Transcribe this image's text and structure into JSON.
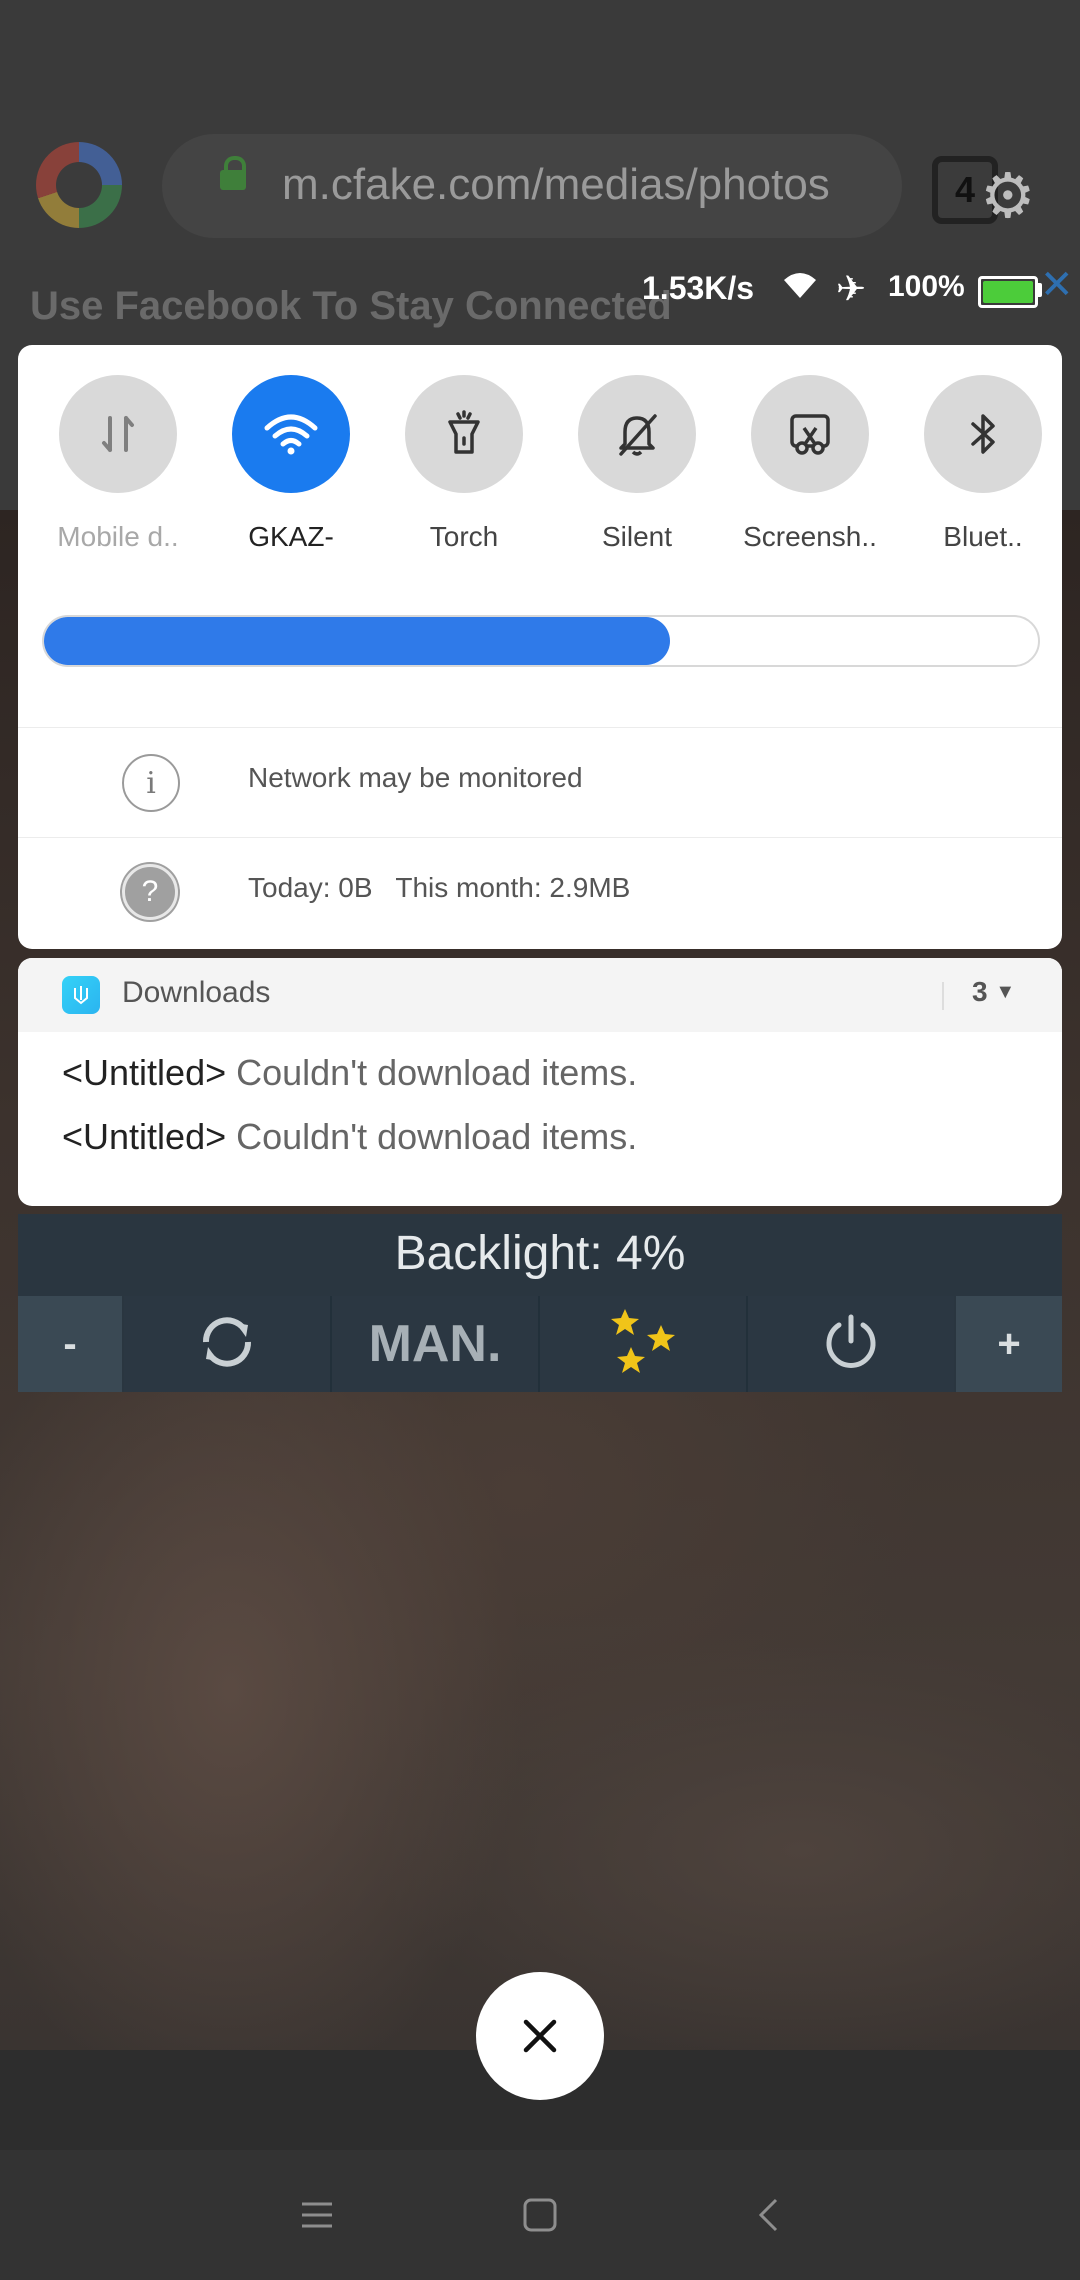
{
  "browser": {
    "url": "m.cfake.com/medias/photos",
    "tab_count": "4",
    "banner_text": "Use Facebook To Stay Connected",
    "banner_close": "✕"
  },
  "status_bar": {
    "speed": "1.53K/s",
    "battery_text": "100%",
    "battery_level": 1.0,
    "battery_color": "#4ccc3a"
  },
  "quick_settings": {
    "tiles": [
      {
        "label": "Mobile d..",
        "icon": "mobile-data-icon",
        "active": false
      },
      {
        "label": "GKAZ-",
        "icon": "wifi-icon",
        "active": true
      },
      {
        "label": "Torch",
        "icon": "torch-icon",
        "active": false
      },
      {
        "label": "Silent",
        "icon": "silent-bell-icon",
        "active": false
      },
      {
        "label": "Screensh..",
        "icon": "screenshot-icon",
        "active": false
      },
      {
        "label": "Bluet..",
        "icon": "bluetooth-icon",
        "active": false
      }
    ],
    "brightness_level": 0.63,
    "accent": "#1a7bef",
    "network_notice": "Network may be monitored",
    "data_usage": "Today: 0B   This month: 2.9MB"
  },
  "downloads": {
    "app_name": "Downloads",
    "count": "3",
    "items": [
      {
        "title": "<Untitled>",
        "message": "Couldn't download items."
      },
      {
        "title": "<Untitled>",
        "message": "Couldn't download items."
      }
    ]
  },
  "backlight": {
    "title": "Backlight: 4%",
    "minus": "-",
    "mode": "MAN.",
    "plus": "+"
  }
}
